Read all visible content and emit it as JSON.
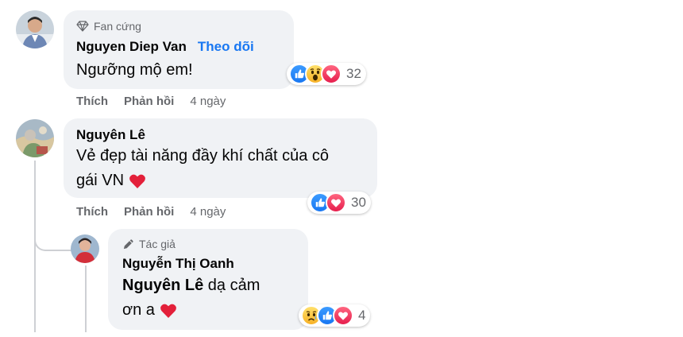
{
  "comments": [
    {
      "badge": "Fan cứng",
      "author": "Nguyen Diep Van",
      "follow_label": "Theo dõi",
      "text": "Ngưỡng mộ em!",
      "reaction_count": "32",
      "actions": {
        "like": "Thích",
        "reply": "Phản hồi",
        "time": "4 ngày"
      }
    },
    {
      "author": "Nguyên Lê",
      "text_line1": "Vẻ đẹp tài năng đầy khí chất của cô",
      "text_line2": "gái VN",
      "reaction_count": "30",
      "actions": {
        "like": "Thích",
        "reply": "Phản hồi",
        "time": "4 ngày"
      }
    }
  ],
  "reply": {
    "badge": "Tác giả",
    "author": "Nguyễn Thị Oanh",
    "mention": "Nguyên Lê",
    "text_line1": " dạ cảm",
    "text_line2": "ơn a",
    "reaction_count": "4"
  },
  "colors": {
    "link": "#1877f2",
    "secondary": "#65676b",
    "bubble": "#f0f2f5"
  },
  "icons": [
    "diamond-icon",
    "pencil-icon",
    "like-reaction-icon",
    "love-reaction-icon",
    "wow-reaction-icon",
    "sad-reaction-icon",
    "heart-emoji-icon"
  ]
}
